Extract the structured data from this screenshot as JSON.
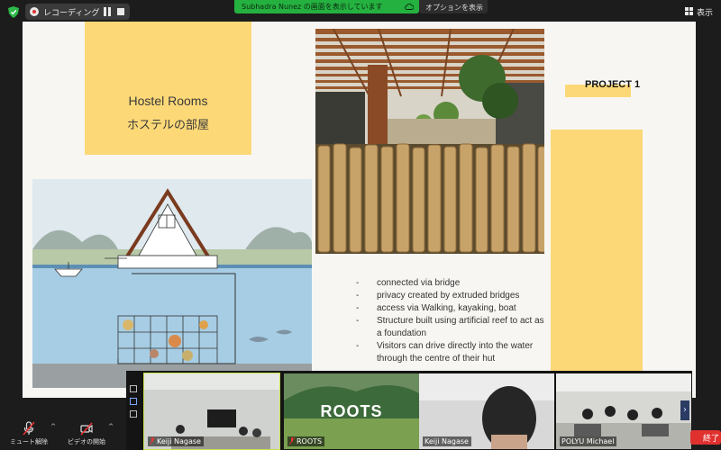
{
  "topbar": {
    "recording_label": "レコーディング...",
    "share_text": "Subhadra Nunez の画面を表示しています",
    "options_label": "オプションを表示",
    "view_label": "表示"
  },
  "slide": {
    "title_en": "Hostel Rooms",
    "title_jp": "ホステルの部屋",
    "project_label": "PROJECT 1",
    "bullets": [
      "connected via bridge",
      "privacy created by extruded bridges",
      "access via Walking, kayaking, boat",
      "Structure built using artificial reef to act as a foundation",
      "Visitors can drive directly into the water through the centre of their hut"
    ]
  },
  "participants": [
    {
      "name": "Keiji Nagase",
      "muted": true,
      "active": true
    },
    {
      "name": "ROOTS",
      "muted": true,
      "active": false
    },
    {
      "name": "Keiji Nagase",
      "muted": false,
      "active": false
    },
    {
      "name": "POLYU Michael",
      "muted": false,
      "active": false
    }
  ],
  "toolbar": {
    "mute_label": "ミュート解除",
    "video_label": "ビデオの開始",
    "end_label": "終了"
  },
  "roots_tile_text": "ROOTS",
  "colors": {
    "slide_accent": "#fcd877",
    "share_banner": "#25b140",
    "active_speaker": "#c8e04a",
    "end_button": "#e0312f"
  }
}
